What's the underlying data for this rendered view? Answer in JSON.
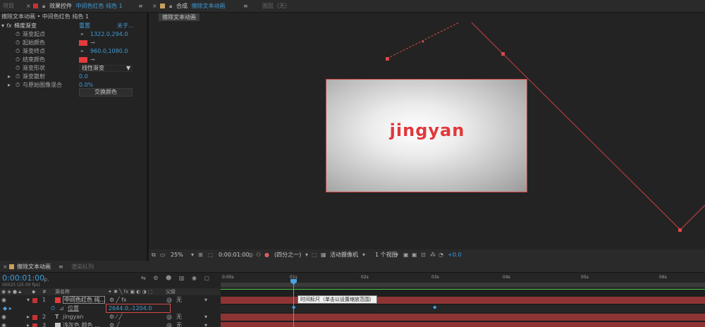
{
  "top_tabs": {
    "project": "项目",
    "effects_panel": "效果控件",
    "effects_layer": "中间色红色 纯色 1",
    "comp_prefix": "合成",
    "comp_name": "擦除文本动画",
    "layer_panel": "图层（无）"
  },
  "effects": {
    "breadcrumb": "擦除文本动画 • 中间色红色 纯色 1",
    "effect_name": "梯度渐变",
    "reset": "重置",
    "about": "关于...",
    "props": [
      {
        "label": "渐变起点",
        "value": "1322.0,294.0"
      },
      {
        "label": "起始颜色",
        "value": ""
      },
      {
        "label": "渐变终点",
        "value": "960.0,1080.0"
      },
      {
        "label": "结束颜色",
        "value": ""
      },
      {
        "label": "渐变形状",
        "value": "线性渐变"
      },
      {
        "label": "渐变散射",
        "value": "0.0"
      },
      {
        "label": "与原始图像混合",
        "value": "0.0%"
      }
    ],
    "swap_button": "交换颜色"
  },
  "composition": {
    "sub_tab": "擦除文本动画",
    "text": "jingyan",
    "toolbar": {
      "zoom": "25%",
      "timecode": "0:00:01:00",
      "resolution": "(四分之一)",
      "camera": "活动摄像机",
      "views": "1 个视图",
      "exposure": "+0.0"
    }
  },
  "timeline": {
    "tab_comp": "擦除文本动画",
    "tab_render": "渲染队列",
    "timecode": "0:00:01:00",
    "frame_info": "00025 (25.00 fps)",
    "search_placeholder": "ρ.",
    "header_num": "#",
    "header_source": "源名称",
    "header_parent": "父级",
    "layers": [
      {
        "num": "1",
        "name": "中间色红色 纯...",
        "parent": "无"
      },
      {
        "num": "",
        "name": "位置",
        "value": "2644.0,-1204.0"
      },
      {
        "num": "2",
        "name": "jingyan",
        "parent": "无"
      },
      {
        "num": "3",
        "name": "浅灰色 颜色 ...",
        "parent": "无"
      }
    ],
    "ruler": [
      "0:00s",
      "01s",
      "02s",
      "03s",
      "04s",
      "05s",
      "06s"
    ],
    "tooltip": "时间标尺（单击以设置缩放范围）"
  }
}
